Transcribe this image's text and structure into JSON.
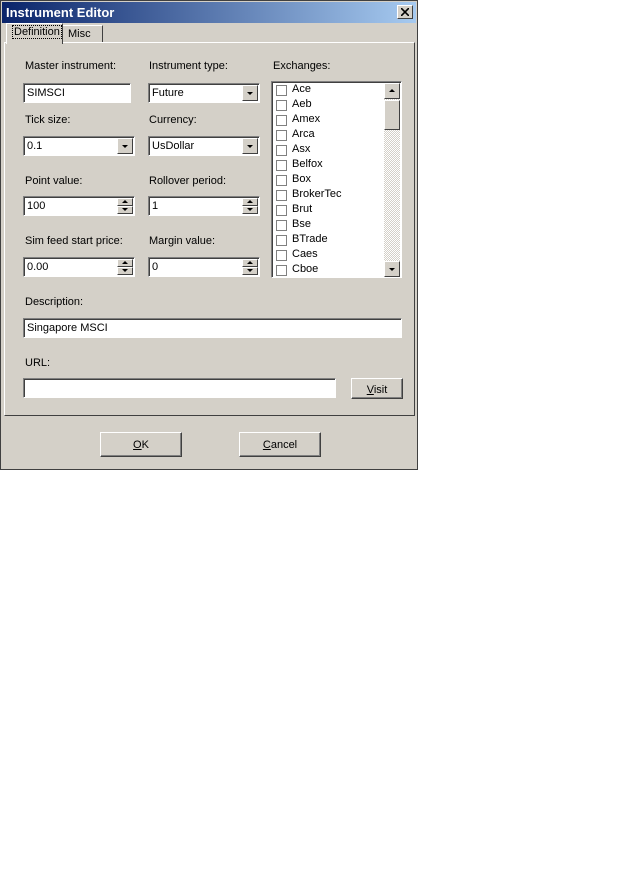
{
  "window": {
    "title": "Instrument Editor"
  },
  "tabs": [
    {
      "label": "Definition",
      "active": true
    },
    {
      "label": "Misc",
      "active": false
    }
  ],
  "fields": {
    "master_instrument": {
      "label": "Master instrument:",
      "value": "SIMSCI"
    },
    "instrument_type": {
      "label": "Instrument type:",
      "value": "Future"
    },
    "tick_size": {
      "label": "Tick size:",
      "value": "0.1"
    },
    "currency": {
      "label": "Currency:",
      "value": "UsDollar"
    },
    "point_value": {
      "label": "Point value:",
      "value": "100"
    },
    "rollover_period": {
      "label": "Rollover period:",
      "value": "1"
    },
    "sim_feed_start_price": {
      "label": "Sim feed start price:",
      "value": "0.00"
    },
    "margin_value": {
      "label": "Margin value:",
      "value": "0"
    },
    "description": {
      "label": "Description:",
      "value": "Singapore MSCI"
    },
    "url": {
      "label": "URL:",
      "value": ""
    }
  },
  "exchanges": {
    "label": "Exchanges:",
    "items": [
      "Ace",
      "Aeb",
      "Amex",
      "Arca",
      "Asx",
      "Belfox",
      "Box",
      "BrokerTec",
      "Brut",
      "Bse",
      "BTrade",
      "Caes",
      "Cboe"
    ]
  },
  "buttons": {
    "visit": {
      "pre": "",
      "accel": "V",
      "post": "isit"
    },
    "ok": {
      "pre": "",
      "accel": "O",
      "post": "K"
    },
    "cancel": {
      "pre": "",
      "accel": "C",
      "post": "ancel"
    }
  },
  "colors": {
    "titlebar_start": "#0a246a",
    "titlebar_end": "#a6caf0",
    "face": "#d4d0c8"
  }
}
